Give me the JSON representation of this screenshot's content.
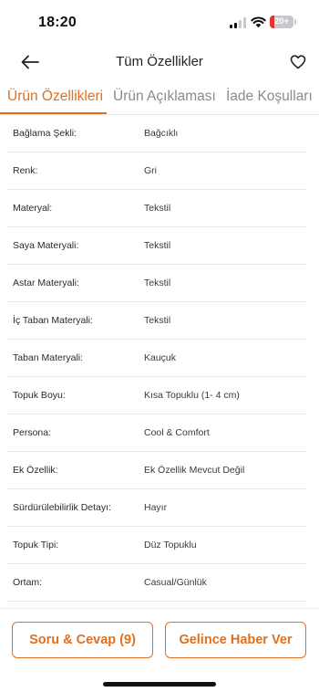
{
  "status_bar": {
    "time": "18:20",
    "battery_label": "20+",
    "battery_level": 0.2,
    "battery_color": "#e0362c",
    "signal_bars_active": 2,
    "signal_bars_total": 4
  },
  "header": {
    "title": "Tüm Özellikler",
    "back_icon": "arrow-left-icon",
    "favorite_icon": "heart-outline-icon"
  },
  "tabs": [
    {
      "label": "Ürün Özellikleri",
      "active": true
    },
    {
      "label": "Ürün Açıklaması",
      "active": false
    },
    {
      "label": "İade Koşulları",
      "active": false
    }
  ],
  "specs": [
    {
      "key": "Bağlama Şekli:",
      "value": "Bağcıklı"
    },
    {
      "key": "Renk:",
      "value": "Gri"
    },
    {
      "key": "Materyal:",
      "value": "Tekstil"
    },
    {
      "key": "Saya Materyali:",
      "value": "Tekstil"
    },
    {
      "key": "Astar Materyali:",
      "value": "Tekstil"
    },
    {
      "key": "İç Taban Materyali:",
      "value": "Tekstil"
    },
    {
      "key": "Taban Materyali:",
      "value": "Kauçuk"
    },
    {
      "key": "Topuk Boyu:",
      "value": "Kısa Topuklu (1- 4 cm)"
    },
    {
      "key": "Persona:",
      "value": "Cool & Comfort"
    },
    {
      "key": "Ek Özellik:",
      "value": "Ek Özellik Mevcut Değil"
    },
    {
      "key": "Sürdürülebilirlik Detayı:",
      "value": "Hayır"
    },
    {
      "key": "Topuk Tipi:",
      "value": "Düz Topuklu"
    },
    {
      "key": "Ortam:",
      "value": "Casual/Günlük"
    }
  ],
  "actions": {
    "qa_label": "Soru & Cevap (9)",
    "notify_label": "Gelince Haber Ver"
  },
  "colors": {
    "accent": "#e0701e",
    "divider": "#e8e8e8",
    "inactive_tab": "#8a8a8a"
  }
}
